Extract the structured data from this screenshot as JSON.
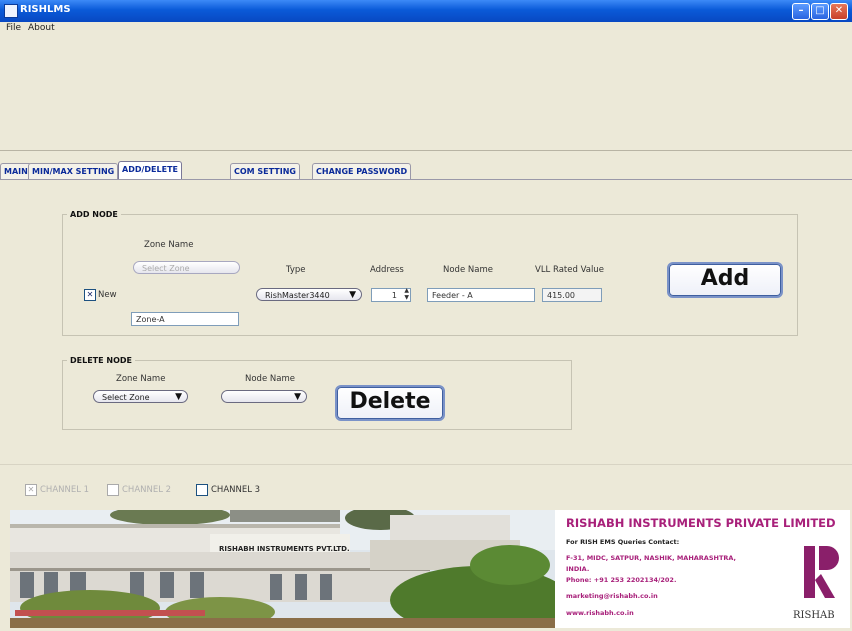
{
  "window": {
    "title": "RISHLMS"
  },
  "menu": [
    {
      "label": "File"
    },
    {
      "label": "About"
    }
  ],
  "tabs": [
    {
      "label": "MAIN"
    },
    {
      "label": "MIN/MAX SETTING"
    },
    {
      "label": "ADD/DELETE"
    },
    {
      "label": "COM SETTING"
    },
    {
      "label": "CHANGE PASSWORD"
    }
  ],
  "add_node": {
    "legend": "ADD NODE",
    "zone_name_label": "Zone Name",
    "zone_select_value": "Select Zone",
    "new_checkbox_label": "New",
    "new_checked": true,
    "new_zone_value": "Zone-A",
    "type_label": "Type",
    "type_value": "RishMaster3440",
    "address_label": "Address",
    "address_value": "1",
    "node_name_label": "Node Name",
    "node_name_value": "Feeder - A",
    "vll_label": "VLL Rated Value",
    "vll_value": "415.00",
    "add_button": "Add"
  },
  "delete_node": {
    "legend": "DELETE NODE",
    "zone_name_label": "Zone Name",
    "zone_select_value": "Select Zone",
    "node_name_label": "Node Name",
    "node_select_value": "",
    "delete_button": "Delete"
  },
  "channels": [
    {
      "label": "CHANNEL 1",
      "enabled": false
    },
    {
      "label": "CHANNEL 2",
      "enabled": false
    },
    {
      "label": "CHANNEL 3",
      "enabled": true
    }
  ],
  "banner": {
    "company": "RISHABH INSTRUMENTS PRIVATE LIMITED",
    "contact_heading": "For RISH EMS Queries Contact:",
    "address_line1": "F-31, MIDC, SATPUR, NASHIK, MAHARASHTRA,",
    "address_line2": "INDIA.",
    "phone": "Phone: +91 253 2202134/202.",
    "email": "marketing@rishabh.co.in",
    "website": "www.rishabh.co.in",
    "logo_text": "RISHAB",
    "building_sign": "RISHABH INSTRUMENTS PVT.LTD."
  },
  "colors": {
    "title_bar": "#0a5ad8",
    "tab_text": "#0a2a9a",
    "company_text": "#a8207a"
  }
}
